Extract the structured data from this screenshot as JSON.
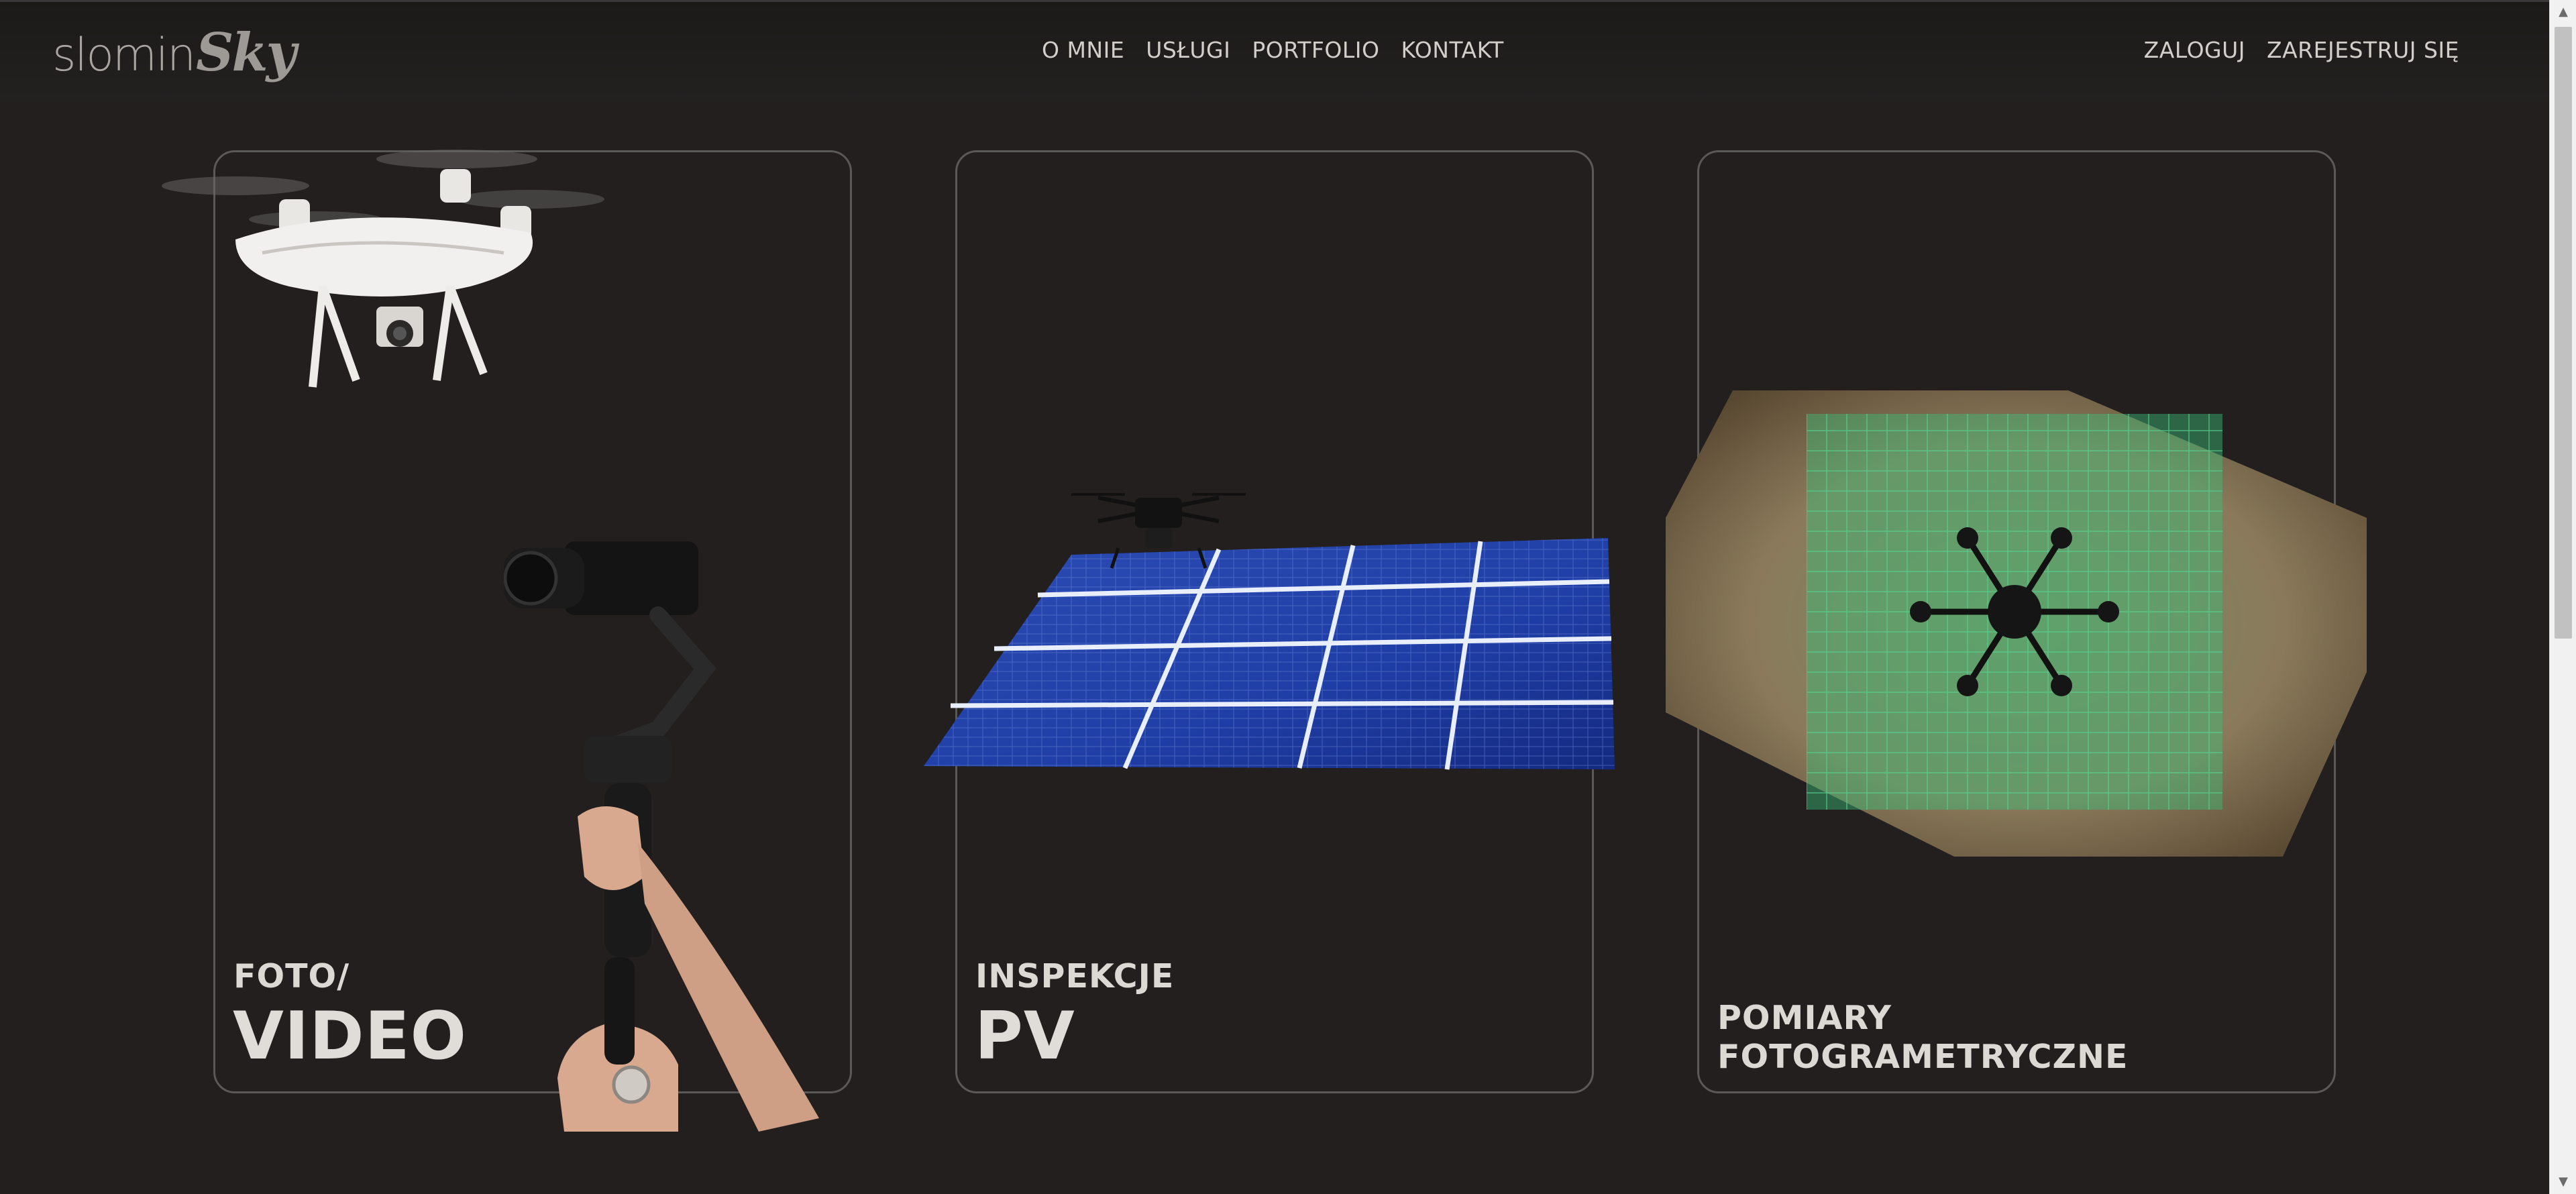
{
  "brand": {
    "logo_light": "slomin",
    "logo_bold": "Sky"
  },
  "nav": {
    "center": [
      "O MNIE",
      "USŁUGI",
      "PORTFOLIO",
      "KONTAKT"
    ],
    "right": [
      "ZALOGUJ",
      "ZAREJESTRUJ SIĘ"
    ]
  },
  "cards": [
    {
      "small": "FOTO/",
      "big": "VIDEO",
      "icon": "drone-and-camera-gimbal"
    },
    {
      "small": "INSPEKCJE",
      "big": "PV",
      "icon": "solar-panel-drone"
    },
    {
      "small": "POMIARY FOTOGRAMETRYCZNE",
      "big": "",
      "icon": "aerial-survey-map"
    }
  ],
  "colors": {
    "background": "#221f1e",
    "card_border": "#5b5957",
    "text": "#e0dcd8"
  }
}
